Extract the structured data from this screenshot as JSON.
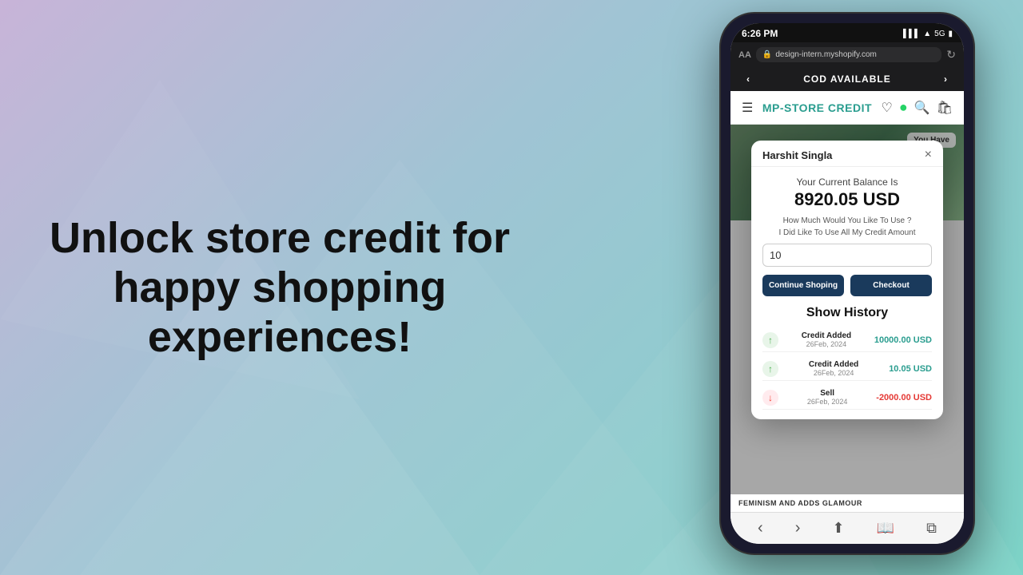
{
  "background": {
    "gradient_start": "#c8b4d8",
    "gradient_end": "#7dd4c8"
  },
  "left": {
    "headline_line1": "Unlock store credit for",
    "headline_line2": "happy shopping",
    "headline_line3": "experiences!"
  },
  "phone": {
    "status_bar": {
      "time": "6:26 PM",
      "signal": "5G"
    },
    "browser": {
      "aa_label": "AA",
      "url": "design-intern.myshopify.com",
      "lock_icon": "🔒"
    },
    "cod_banner": {
      "text": "COD AVAILABLE",
      "left_arrow": "‹",
      "right_arrow": "›"
    },
    "store_nav": {
      "menu_icon": "☰",
      "title": "MP-STORE CREDIT",
      "heart_icon": "♡",
      "whatsapp_icon": "●",
      "search_icon": "🔍",
      "cart_icon": "🛍"
    },
    "you_have_badge": "You Have",
    "modal": {
      "user_name": "Harshit Singla",
      "close_icon": "×",
      "balance_label": "Your Current Balance Is",
      "balance_amount": "8920.05 USD",
      "use_label": "How Much Would You Like To Use ?",
      "use_all_label": "I Did Like To Use All My Credit Amount",
      "input_value": "10",
      "btn_continue": "Continue Shoping",
      "btn_checkout": "Checkout",
      "history_title": "Show History",
      "history_items": [
        {
          "type": "Credit Added",
          "date": "26Feb, 2024",
          "amount": "10000.00 USD",
          "direction": "up",
          "positive": true
        },
        {
          "type": "Credit Added",
          "date": "26Feb, 2024",
          "amount": "10.05 USD",
          "direction": "up",
          "positive": true
        },
        {
          "type": "Sell",
          "date": "26Feb, 2024",
          "amount": "-2000.00 USD",
          "direction": "down",
          "positive": false
        }
      ]
    },
    "store_bottom_text": "FEMINISM AND ADDS GLAMOUR",
    "browser_bottom": {
      "back": "‹",
      "forward": "›",
      "share": "⬆",
      "bookmark": "📖",
      "tabs": "⧉"
    }
  }
}
